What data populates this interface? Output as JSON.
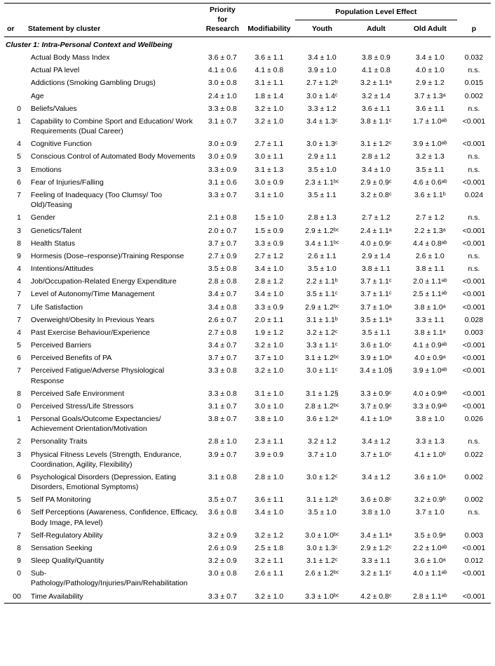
{
  "table": {
    "columns": {
      "or": "or",
      "statement": "Statement by cluster",
      "priority": "Priority for Research",
      "modifiability": "Modifiability",
      "population": "Population Level Effect",
      "youth": "Youth",
      "adult": "Adult",
      "old_adult": "Old Adult",
      "p": "p"
    },
    "cluster1": {
      "label": "Cluster 1: Intra-Personal Context and Wellbeing"
    },
    "rows": [
      {
        "or": "",
        "statement": "Actual Body Mass Index",
        "priority": "3.6 ± 0.7",
        "modif": "3.6 ± 1.1",
        "youth": "3.4 ± 1.0",
        "adult": "3.8 ± 0.9",
        "old_adult": "3.4 ± 1.0",
        "p": "0.032"
      },
      {
        "or": "",
        "statement": "Actual PA level",
        "priority": "4.1 ± 0.6",
        "modif": "4.1 ± 0.8",
        "youth": "3.9 ± 1.0",
        "adult": "4.1 ± 0.8",
        "old_adult": "4.0 ± 1.0",
        "p": "n.s."
      },
      {
        "or": "",
        "statement": "Addictions (Smoking Gambling Drugs)",
        "priority": "3.0 ± 0.8",
        "modif": "3.1 ± 1.1",
        "youth": "2.7 ± 1.2ᵇ",
        "adult": "3.2 ± 1.1ᵃ",
        "old_adult": "2.9 ± 1.2",
        "p": "0.015"
      },
      {
        "or": "",
        "statement": "Age",
        "priority": "2.4 ± 1.0",
        "modif": "1.8 ± 1.4",
        "youth": "3.0 ± 1.4ᶜ",
        "adult": "3.2 ± 1.4",
        "old_adult": "3.7 ± 1.3ᵃ",
        "p": "0.002"
      },
      {
        "or": "0",
        "statement": "Beliefs/Values",
        "priority": "3.3 ± 0.8",
        "modif": "3.2 ± 1.0",
        "youth": "3.3 ± 1.2",
        "adult": "3.6 ± 1.1",
        "old_adult": "3.6 ± 1.1",
        "p": "n.s."
      },
      {
        "or": "1",
        "statement": "Capability to Combine Sport and Education/ Work Requirements (Dual Career)",
        "priority": "3.1 ± 0.7",
        "modif": "3.2 ± 1.0",
        "youth": "3.4 ± 1.3ᶜ",
        "adult": "3.8 ± 1.1ᶜ",
        "old_adult": "1.7 ± 1.0ᵃᵇ",
        "p": "<0.001"
      },
      {
        "or": "4",
        "statement": "Cognitive Function",
        "priority": "3.0 ± 0.9",
        "modif": "2.7 ± 1.1",
        "youth": "3.0 ± 1.3ᶜ",
        "adult": "3.1 ± 1.2ᶜ",
        "old_adult": "3.9 ± 1.0ᵃᵇ",
        "p": "<0.001"
      },
      {
        "or": "5",
        "statement": "Conscious Control of Automated Body Movements",
        "priority": "3.0 ± 0.9",
        "modif": "3.0 ± 1.1",
        "youth": "2.9 ± 1.1",
        "adult": "2.8 ± 1.2",
        "old_adult": "3.2 ± 1.3",
        "p": "n.s."
      },
      {
        "or": "3",
        "statement": "Emotions",
        "priority": "3.3 ± 0.9",
        "modif": "3.1 ± 1.3",
        "youth": "3.5 ± 1.0",
        "adult": "3.4 ± 1.0",
        "old_adult": "3.5 ± 1.1",
        "p": "n.s."
      },
      {
        "or": "6",
        "statement": "Fear of Injuries/Falling",
        "priority": "3.1 ± 0.6",
        "modif": "3.0 ± 0.9",
        "youth": "2.3 ± 1.1ᵇᶜ",
        "adult": "2.9 ± 0.9ᶜ",
        "old_adult": "4.6 ± 0.6ᵃᵇ",
        "p": "<0.001"
      },
      {
        "or": "7",
        "statement": "Feeling of Inadequacy (Too Clumsy/ Too Old)/Teasing",
        "priority": "3.3 ± 0.7",
        "modif": "3.1 ± 1.0",
        "youth": "3.5 ± 1.1",
        "adult": "3.2 ± 0.8ᶜ",
        "old_adult": "3.6 ± 1.1ᵇ",
        "p": "0.024"
      },
      {
        "or": "1",
        "statement": "Gender",
        "priority": "2.1 ± 0.8",
        "modif": "1.5 ± 1.0",
        "youth": "2.8 ± 1.3",
        "adult": "2.7 ± 1.2",
        "old_adult": "2.7 ± 1.2",
        "p": "n.s."
      },
      {
        "or": "3",
        "statement": "Genetics/Talent",
        "priority": "2.0 ± 0.7",
        "modif": "1.5 ± 0.9",
        "youth": "2.9 ± 1.2ᵇᶜ",
        "adult": "2.4 ± 1.1ᵃ",
        "old_adult": "2.2 ± 1.3ᵃ",
        "p": "<0.001"
      },
      {
        "or": "8",
        "statement": "Health Status",
        "priority": "3.7 ± 0.7",
        "modif": "3.3 ± 0.9",
        "youth": "3.4 ± 1.1ᵇᶜ",
        "adult": "4.0 ± 0.9ᶜ",
        "old_adult": "4.4 ± 0.8ᵃᵇ",
        "p": "<0.001"
      },
      {
        "or": "9",
        "statement": "Hormesis (Dose–response)/Training Response",
        "priority": "2.7 ± 0.9",
        "modif": "2.7 ± 1.2",
        "youth": "2.6 ± 1.1",
        "adult": "2.9 ± 1.4",
        "old_adult": "2.6 ± 1.0",
        "p": "n.s."
      },
      {
        "or": "4",
        "statement": "Intentions/Attitudes",
        "priority": "3.5 ± 0.8",
        "modif": "3.4 ± 1.0",
        "youth": "3.5 ± 1.0",
        "adult": "3.8 ± 1.1",
        "old_adult": "3.8 ± 1.1",
        "p": "n.s."
      },
      {
        "or": "4",
        "statement": "Job/Occupation-Related Energy Expenditure",
        "priority": "2.8 ± 0.8",
        "modif": "2.8 ± 1.2",
        "youth": "2.2 ± 1.1ᵇ",
        "adult": "3.7 ± 1.1ᶜ",
        "old_adult": "2.0 ± 1.1ᵃᵇ",
        "p": "<0.001"
      },
      {
        "or": "7",
        "statement": "Level of Autonomy/Time Management",
        "priority": "3.4 ± 0.7",
        "modif": "3.4 ± 1.0",
        "youth": "3.5 ± 1.1ᶜ",
        "adult": "3.7 ± 1.1ᶜ",
        "old_adult": "2.5 ± 1.1ᵃᵇ",
        "p": "<0.001"
      },
      {
        "or": "7",
        "statement": "Life Satisfaction",
        "priority": "3.4 ± 0.8",
        "modif": "3.3 ± 0.9",
        "youth": "2.9 ± 1.2ᵇᶜ",
        "adult": "3.7 ± 1.0ᵃ",
        "old_adult": "3.8 ± 1.0ᵃ",
        "p": "<0.001"
      },
      {
        "or": "7",
        "statement": "Overweight/Obesity In Previous Years",
        "priority": "2.6 ± 0.7",
        "modif": "2.0 ± 1.1",
        "youth": "3.1 ± 1.1ᵇ",
        "adult": "3.5 ± 1.1ᵃ",
        "old_adult": "3.3 ± 1.1",
        "p": "0.028"
      },
      {
        "or": "4",
        "statement": "Past Exercise Behaviour/Experience",
        "priority": "2.7 ± 0.8",
        "modif": "1.9 ± 1.2",
        "youth": "3.2 ± 1.2ᶜ",
        "adult": "3.5 ± 1.1",
        "old_adult": "3.8 ± 1.1ᵃ",
        "p": "0.003"
      },
      {
        "or": "5",
        "statement": "Perceived Barriers",
        "priority": "3.4 ± 0.7",
        "modif": "3.2 ± 1.0",
        "youth": "3.3 ± 1.1ᶜ",
        "adult": "3.6 ± 1.0ᶜ",
        "old_adult": "4.1 ± 0.9ᵃᵇ",
        "p": "<0.001"
      },
      {
        "or": "6",
        "statement": "Perceived Benefits of PA",
        "priority": "3.7 ± 0.7",
        "modif": "3.7 ± 1.0",
        "youth": "3.1 ± 1.2ᵇᶜ",
        "adult": "3.9 ± 1.0ᵃ",
        "old_adult": "4.0 ± 0.9ᵃ",
        "p": "<0.001"
      },
      {
        "or": "7",
        "statement": "Perceived Fatigue/Adverse Physiological Response",
        "priority": "3.3 ± 0.8",
        "modif": "3.2 ± 1.0",
        "youth": "3.0 ± 1.1ᶜ",
        "adult": "3.4 ± 1.0§",
        "old_adult": "3.9 ± 1.0ᵃᵇ",
        "p": "<0.001"
      },
      {
        "or": "8",
        "statement": "Perceived Safe Environment",
        "priority": "3.3 ± 0.8",
        "modif": "3.1 ± 1.0",
        "youth": "3.1 ± 1.2§",
        "adult": "3.3 ± 0.9ᶜ",
        "old_adult": "4.0 ± 0.9ᵃᵇ",
        "p": "<0.001"
      },
      {
        "or": "0",
        "statement": "Perceived Stress/Life Stressors",
        "priority": "3.1 ± 0.7",
        "modif": "3.0 ± 1.0",
        "youth": "2.8 ± 1.2ᵇᶜ",
        "adult": "3.7 ± 0.9ᶜ",
        "old_adult": "3.3 ± 0.9ᵃᵇ",
        "p": "<0.001"
      },
      {
        "or": "1",
        "statement": "Personal Goals/Outcome Expectancies/ Achievement Orientation/Motivation",
        "priority": "3.8 ± 0.7",
        "modif": "3.8 ± 1.0",
        "youth": "3.6 ± 1.2ᵃ",
        "adult": "4.1 ± 1.0ᵃ",
        "old_adult": "3.8 ± 1.0",
        "p": "0.026"
      },
      {
        "or": "2",
        "statement": "Personality Traits",
        "priority": "2.8 ± 1.0",
        "modif": "2.3 ± 1.1",
        "youth": "3.2 ± 1.2",
        "adult": "3.4 ± 1.2",
        "old_adult": "3.3 ± 1.3",
        "p": "n.s."
      },
      {
        "or": "3",
        "statement": "Physical Fitness Levels (Strength, Endurance, Coordination, Agility, Flexibility)",
        "priority": "3.9 ± 0.7",
        "modif": "3.9 ± 0.9",
        "youth": "3.7 ± 1.0",
        "adult": "3.7 ± 1.0ᶜ",
        "old_adult": "4.1 ± 1.0ᵇ",
        "p": "0.022"
      },
      {
        "or": "6",
        "statement": "Psychological Disorders (Depression, Eating Disorders, Emotional Symptoms)",
        "priority": "3.1 ± 0.8",
        "modif": "2.8 ± 1.0",
        "youth": "3.0 ± 1.2ᶜ",
        "adult": "3.4 ± 1.2",
        "old_adult": "3.6 ± 1.0ᵃ",
        "p": "0.002"
      },
      {
        "or": "5",
        "statement": "Self PA Monitoring",
        "priority": "3.5 ± 0.7",
        "modif": "3.6 ± 1.1",
        "youth": "3.1 ± 1.2ᵇ",
        "adult": "3.6 ± 0.8ᶜ",
        "old_adult": "3.2 ± 0.9ᵇ",
        "p": "0.002"
      },
      {
        "or": "6",
        "statement": "Self Perceptions (Awareness, Confidence, Efficacy, Body Image, PA level)",
        "priority": "3.6 ± 0.8",
        "modif": "3.4 ± 1.0",
        "youth": "3.5 ± 1.0",
        "adult": "3.8 ± 1.0",
        "old_adult": "3.7 ± 1.0",
        "p": "n.s."
      },
      {
        "or": "7",
        "statement": "Self-Regulatory Ability",
        "priority": "3.2 ± 0.9",
        "modif": "3.2 ± 1.2",
        "youth": "3.0 ± 1.0ᵇᶜ",
        "adult": "3.4 ± 1.1ᵃ",
        "old_adult": "3.5 ± 0.9ᵃ",
        "p": "0.003"
      },
      {
        "or": "8",
        "statement": "Sensation Seeking",
        "priority": "2.6 ± 0.9",
        "modif": "2.5 ± 1.8",
        "youth": "3.0 ± 1.3ᶜ",
        "adult": "2.9 ± 1.2ᶜ",
        "old_adult": "2.2 ± 1.0ᵃᵇ",
        "p": "<0.001"
      },
      {
        "or": "9",
        "statement": "Sleep Quality/Quantity",
        "priority": "3.2 ± 0.9",
        "modif": "3.2 ± 1.1",
        "youth": "3.1 ± 1.2ᶜ",
        "adult": "3.3 ± 1.1",
        "old_adult": "3.6 ± 1.0ᵃ",
        "p": "0.012"
      },
      {
        "or": "0",
        "statement": "Sub-Pathology/Pathology/Injuries/Pain/Rehabilitation",
        "priority": "3.0 ± 0.8",
        "modif": "2.6 ± 1.1",
        "youth": "2.6 ± 1.2ᵇᶜ",
        "adult": "3.2 ± 1.1ᶜ",
        "old_adult": "4.0 ± 1.1ᵃᵇ",
        "p": "<0.001"
      },
      {
        "or": "00",
        "statement": "Time Availability",
        "priority": "3.3 ± 0.7",
        "modif": "3.2 ± 1.0",
        "youth": "3.3 ± 1.0ᵇᶜ",
        "adult": "4.2 ± 0.8ᶜ",
        "old_adult": "2.8 ± 1.1ᵃᵇ",
        "p": "<0.001"
      }
    ]
  }
}
